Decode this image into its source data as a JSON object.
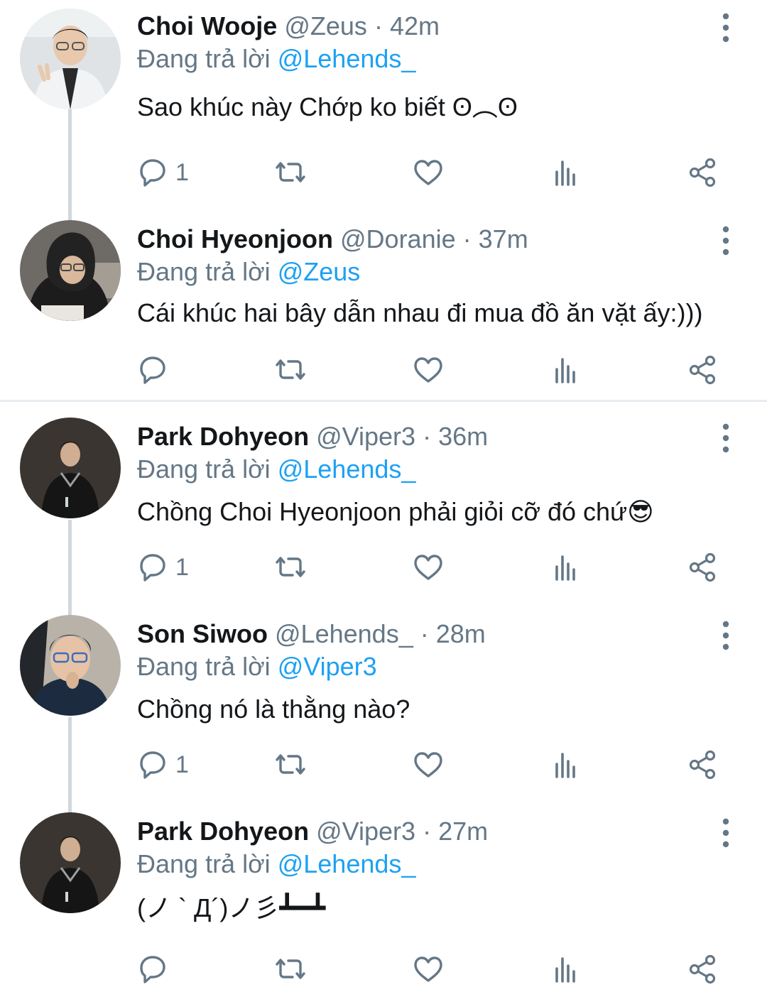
{
  "replying_label": "Đang trả lời",
  "colors": {
    "link": "#1da1f2",
    "secondary_text": "#657786",
    "primary_text": "#14171a",
    "thread_line": "#d0d8de",
    "separator": "#e6ecf0"
  },
  "icons": [
    "reply-icon",
    "retweet-icon",
    "like-icon",
    "analytics-icon",
    "share-icon",
    "more-options-icon"
  ],
  "tweets": [
    {
      "name": "Choi Wooje",
      "handle": "@Zeus",
      "dot": "·",
      "time": "42m",
      "replying_to": "@Lehends_",
      "text": "Sao khúc này Chớp ko biết ʘ︵ʘ",
      "reply_count": "1"
    },
    {
      "name": "Choi Hyeonjoon",
      "handle": "@Doranie",
      "dot": "·",
      "time": "37m",
      "replying_to": "@Zeus",
      "text": "Cái khúc hai bây dẫn nhau đi mua đồ ăn vặt ấy:)))",
      "reply_count": ""
    },
    {
      "name": "Park Dohyeon",
      "handle": "@Viper3",
      "dot": "·",
      "time": "36m",
      "replying_to": "@Lehends_",
      "text": "Chồng Choi Hyeonjoon phải giỏi cỡ đó chứ😎",
      "reply_count": "1"
    },
    {
      "name": "Son Siwoo",
      "handle": "@Lehends_",
      "dot": "·",
      "time": "28m",
      "replying_to": "@Viper3",
      "text": "Chồng nó là thằng nào?",
      "reply_count": "1"
    },
    {
      "name": "Park Dohyeon",
      "handle": "@Viper3",
      "dot": "·",
      "time": "27m",
      "replying_to": "@Lehends_",
      "text": "(ノ ` Д´)ノ彡┻━┻",
      "reply_count": ""
    }
  ]
}
